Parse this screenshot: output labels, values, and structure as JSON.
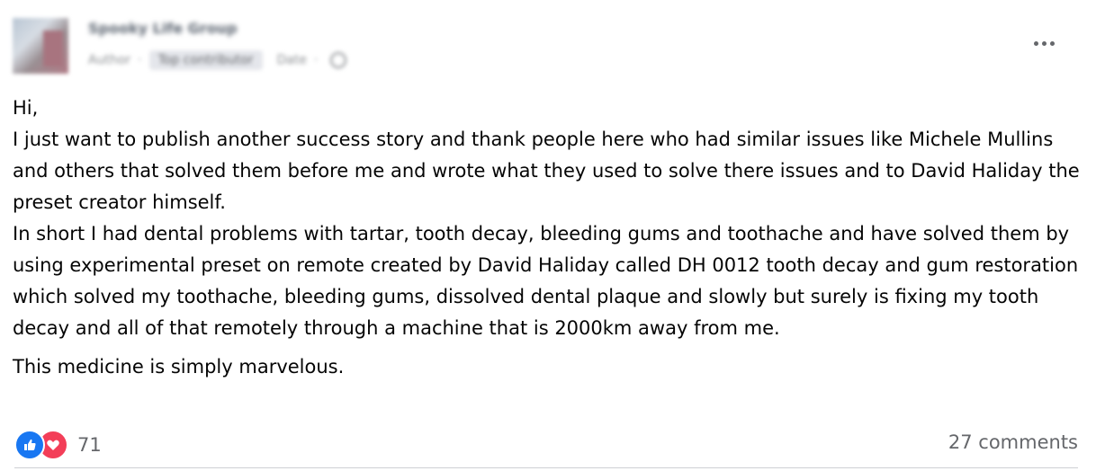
{
  "post": {
    "paragraphs": [
      "Hi,",
      "I just want to publish another success story and thank people here who had similar issues like Michele Mullins and others that solved them before me and wrote what they used to solve there issues and to David Haliday the preset creator himself.",
      "In short I had dental problems with tartar, tooth decay, bleeding gums and toothache and have solved them by using experimental preset on remote created by David Haliday called DH 0012 tooth decay and gum restoration which solved my toothache, bleeding gums, dissolved dental plaque  and slowly but surely is fixing my tooth decay and all of that remotely through a machine that is 2000km away from me.",
      "This medicine is simply marvelous."
    ]
  },
  "footer": {
    "reaction_count": "71",
    "comments": "27 comments"
  },
  "colors": {
    "like": "#1877f2",
    "love": "#f33e58",
    "muted_text": "#65676b"
  }
}
